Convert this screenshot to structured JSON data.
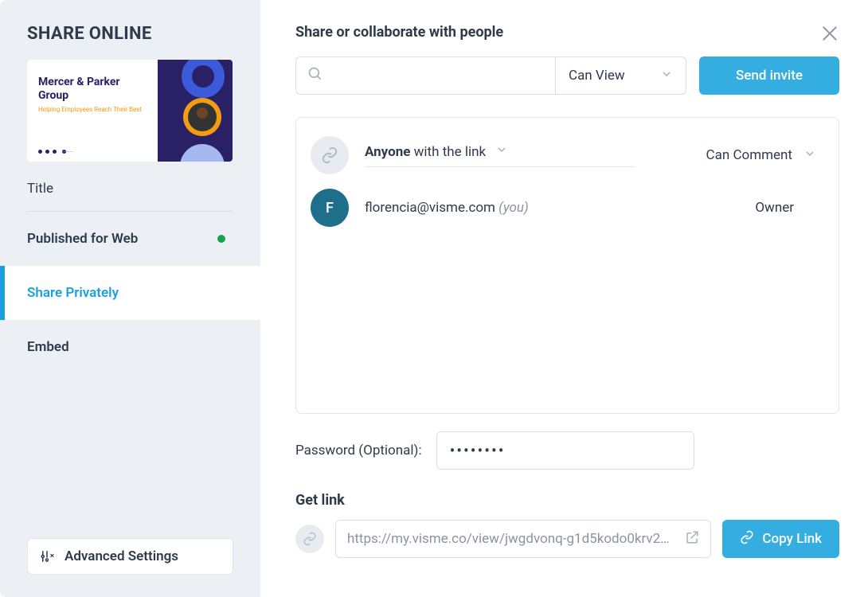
{
  "sidebar": {
    "title": "SHARE ONLINE",
    "thumbnail": {
      "brand_line1": "Mercer & Parker",
      "brand_line2": "Group",
      "tagline": "Helping Employees Reach Their Best"
    },
    "title_label": "Title",
    "nav": [
      {
        "label": "Published for Web"
      },
      {
        "label": "Share Privately"
      },
      {
        "label": "Embed"
      }
    ],
    "advanced_settings_label": "Advanced Settings"
  },
  "main": {
    "share_heading": "Share or collaborate with people",
    "permission_select_default": "Can View",
    "send_invite_label": "Send invite",
    "anyone_bold": "Anyone",
    "anyone_rest": "with the link",
    "anyone_permission": "Can Comment",
    "owner": {
      "initial": "F",
      "email": "florencia@visme.com",
      "you_label": "(you)",
      "role": "Owner"
    },
    "password_label": "Password (Optional):",
    "password_value": "••••••••",
    "getlink_heading": "Get link",
    "link_url": "https://my.visme.co/view/jwgdvonq-g1d5kodo0krv2…",
    "copy_link_label": "Copy Link"
  }
}
